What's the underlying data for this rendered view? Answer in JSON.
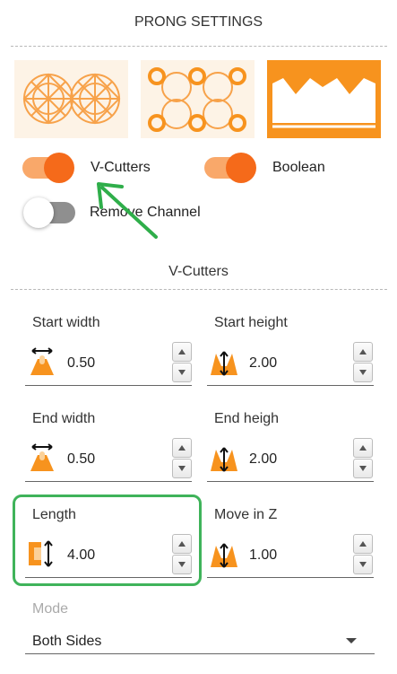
{
  "header": {
    "title": "PRONG SETTINGS"
  },
  "thumbnails": [
    {
      "name": "round-stones-thumbnail",
      "selected": false
    },
    {
      "name": "prong-grid-thumbnail",
      "selected": false
    },
    {
      "name": "v-cutters-thumbnail",
      "selected": true
    }
  ],
  "toggles": {
    "v_cutters": {
      "label": "V-Cutters",
      "on": true
    },
    "boolean": {
      "label": "Boolean",
      "on": true
    },
    "remove_channel": {
      "label": "Remove Channel",
      "on": false
    }
  },
  "section": {
    "title": "V-Cutters"
  },
  "fields": {
    "start_width": {
      "label": "Start width",
      "value": "0.50",
      "icon": "width-arrow-icon"
    },
    "start_height": {
      "label": "Start height",
      "value": "2.00",
      "icon": "height-arrow-icon"
    },
    "end_width": {
      "label": "End width",
      "value": "0.50",
      "icon": "width-arrow-icon"
    },
    "end_height": {
      "label": "End heigh",
      "value": "2.00",
      "icon": "height-arrow-icon"
    },
    "length": {
      "label": "Length",
      "value": "4.00",
      "icon": "length-arrow-icon"
    },
    "move_z": {
      "label": "Move in Z",
      "value": "1.00",
      "icon": "height-arrow-icon"
    }
  },
  "mode": {
    "label": "Mode",
    "selected": "Both Sides"
  },
  "colors": {
    "accent": "#f7931e",
    "toggle_track_on": "#f9a86a",
    "highlight": "#3fb35a",
    "annotation_arrow": "#2fae4a"
  }
}
